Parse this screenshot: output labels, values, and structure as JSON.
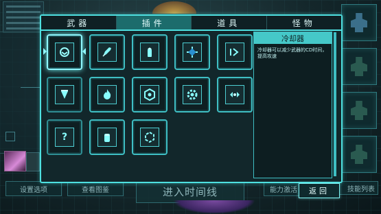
{
  "tabs": [
    "武器",
    "插件",
    "道具",
    "怪物"
  ],
  "active_tab": 1,
  "slots": [
    {
      "icon": "cooldown-icon",
      "selected": true
    },
    {
      "icon": "rocket-icon"
    },
    {
      "icon": "bullet-icon"
    },
    {
      "icon": "crosshair-icon"
    },
    {
      "icon": "arrow-forward-icon"
    },
    {
      "icon": "shield-drop-icon"
    },
    {
      "icon": "flame-icon"
    },
    {
      "icon": "hexagon-icon"
    },
    {
      "icon": "gear-icon"
    },
    {
      "icon": "expand-icon"
    },
    {
      "icon": "question-icon",
      "text": "?"
    },
    {
      "icon": "capsule-icon"
    },
    {
      "icon": "hex-frame-icon"
    }
  ],
  "detail": {
    "title": "冷却器",
    "description": "冷却器可以减少武器的CD时间，提高攻速"
  },
  "background": {
    "buttons": {
      "settings": "设置选项",
      "gallery": "查看图鉴",
      "enter": "进入时间线",
      "ability": "能力激活",
      "skills": "技能列表"
    }
  },
  "back_label": "返回",
  "colors": {
    "accent": "#4ee0e0",
    "panel": "#12272b",
    "highlight": "#45c8c8"
  }
}
